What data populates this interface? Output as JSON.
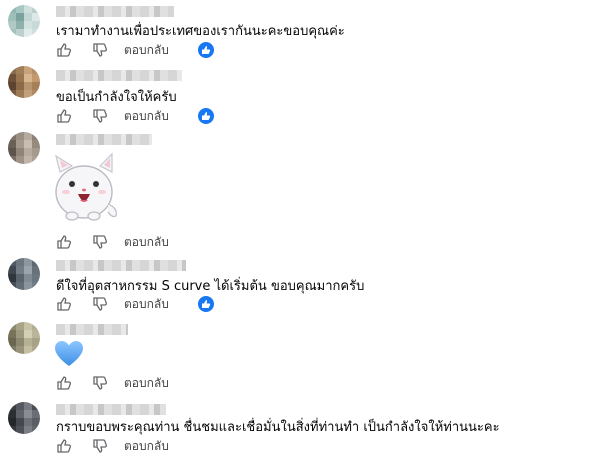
{
  "comments": [
    {
      "text": "เรามาทำงานเพื่อประเทศของเรากันนะคะขอบคุณค่ะ",
      "reply_label": "ตอบกลับ",
      "liked_badge": true,
      "avatar_colors": [
        "#8fb7b3",
        "#a9c7c2",
        "#cfe0dc",
        "#b8cfcb",
        "#9fbfbb",
        "#7aa39f",
        "#c2d6d3",
        "#dde9e7",
        "#b1c9c6",
        "#8fb1ad",
        "#d2e2df",
        "#c7dad7",
        "#a6c2be",
        "#bcd1ce",
        "#e1ecea",
        "#cfdfdc"
      ]
    },
    {
      "text": "ขอเป็นกำลังใจให้ครับ",
      "reply_label": "ตอบกลับ",
      "liked_badge": true,
      "avatar_colors": [
        "#8a6d4d",
        "#a07f5a",
        "#c9a27a",
        "#b88e66",
        "#6e5138",
        "#9a7550",
        "#d6b58f",
        "#c4996e",
        "#5e4330",
        "#8c6a49",
        "#b89571",
        "#a58058",
        "#7a5a3f",
        "#9d7b56",
        "#c3a07c",
        "#b08a62"
      ]
    },
    {
      "text": "",
      "reply_label": "ตอบกลับ",
      "liked_badge": false,
      "sticker": "white-cat-sticker",
      "avatar_colors": [
        "#7d7368",
        "#9a8f83",
        "#b4aa9d",
        "#8c8175",
        "#6a6056",
        "#a39889",
        "#c8bdb0",
        "#968a7c",
        "#5c534b",
        "#8f8477",
        "#b6ab9f",
        "#a49a8d",
        "#786e63",
        "#9e9386",
        "#bfb5a9",
        "#aca194"
      ]
    },
    {
      "text": "ดีใจที่อุตสาหกรรม S curve ได้เริ่มต้น ขอบคุณมากครับ",
      "reply_label": "ตอบกลับ",
      "liked_badge": true,
      "avatar_colors": [
        "#4f5a63",
        "#6a7680",
        "#8c969e",
        "#5d6870",
        "#3e474f",
        "#717c85",
        "#9aa4ab",
        "#66717a",
        "#2f373e",
        "#58636b",
        "#7f8a92",
        "#6b767e",
        "#454e56",
        "#616c74",
        "#8a949b",
        "#727d85"
      ]
    },
    {
      "text": "",
      "reply_label": "ตอบกลับ",
      "liked_badge": false,
      "heart": "blue-heart",
      "avatar_colors": [
        "#8f8a6e",
        "#a9a487",
        "#c7c2a5",
        "#b3ae91",
        "#77725a",
        "#9d9880",
        "#d3cfb4",
        "#bab59a",
        "#6a664f",
        "#8b8770",
        "#b6b195",
        "#a6a187",
        "#7f7a62",
        "#98947c",
        "#c4bfa3",
        "#aea98e"
      ]
    },
    {
      "text": "กราบขอบพระคุณท่าน ชื่นชมและเชื่อมั่นในสิ่งที่ท่านทำ เป็นกำลังใจให้ท่านนะคะ",
      "reply_label": "ตอบกลับ",
      "liked_badge": false,
      "avatar_colors": [
        "#3b3f45",
        "#55595f",
        "#777b81",
        "#4a4e54",
        "#2b2e33",
        "#5f6369",
        "#8a8e93",
        "#6a6e74",
        "#23262a",
        "#44484e",
        "#6d7177",
        "#5a5e64",
        "#34373c",
        "#4e5258",
        "#7b7f84",
        "#63676d"
      ]
    }
  ],
  "colors": {
    "like_blue": "#1877f2",
    "heart_blue": "#4a9bf0",
    "text": "#050505",
    "muted": "#65676b"
  },
  "icons": {
    "like": "thumbs-up-icon",
    "dislike": "thumbs-down-icon",
    "badge": "like-badge-icon"
  }
}
